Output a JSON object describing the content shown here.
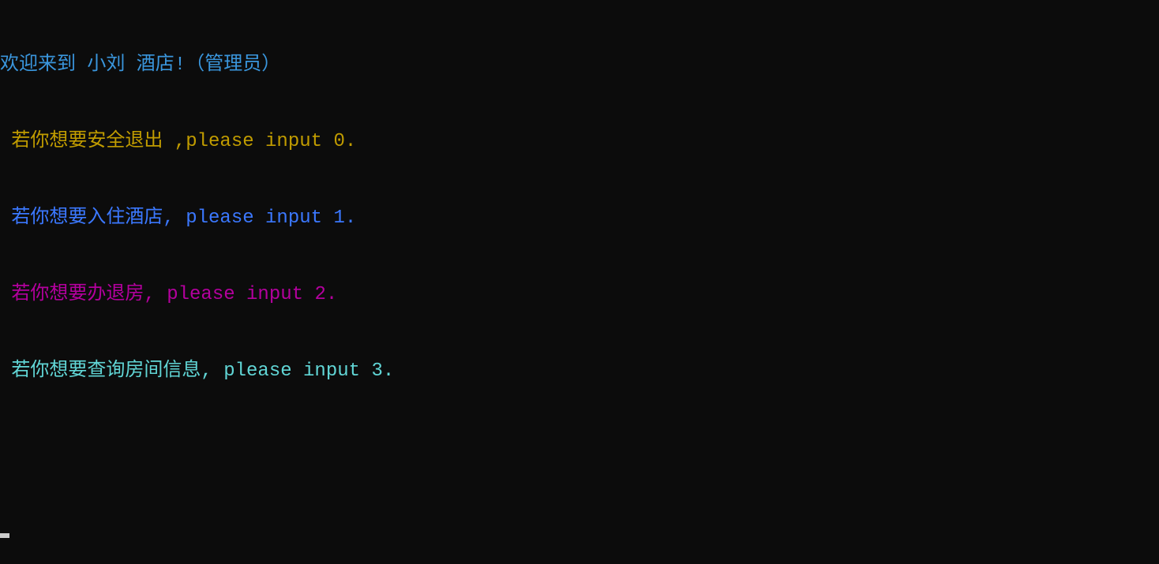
{
  "terminal": {
    "lines": [
      {
        "text": "欢迎来到 小刘 酒店!（管理员）",
        "colorClass": "cyan",
        "indent": ""
      },
      {
        "text": "若你想要安全退出 ,please input 0.",
        "colorClass": "yellow",
        "indent": " "
      },
      {
        "text": "若你想要入住酒店, please input 1.",
        "colorClass": "blue",
        "indent": " "
      },
      {
        "text": "若你想要办退房, please input 2.",
        "colorClass": "magenta",
        "indent": " "
      },
      {
        "text": "若你想要查询房间信息, please input 3.",
        "colorClass": "teal",
        "indent": " "
      }
    ]
  }
}
